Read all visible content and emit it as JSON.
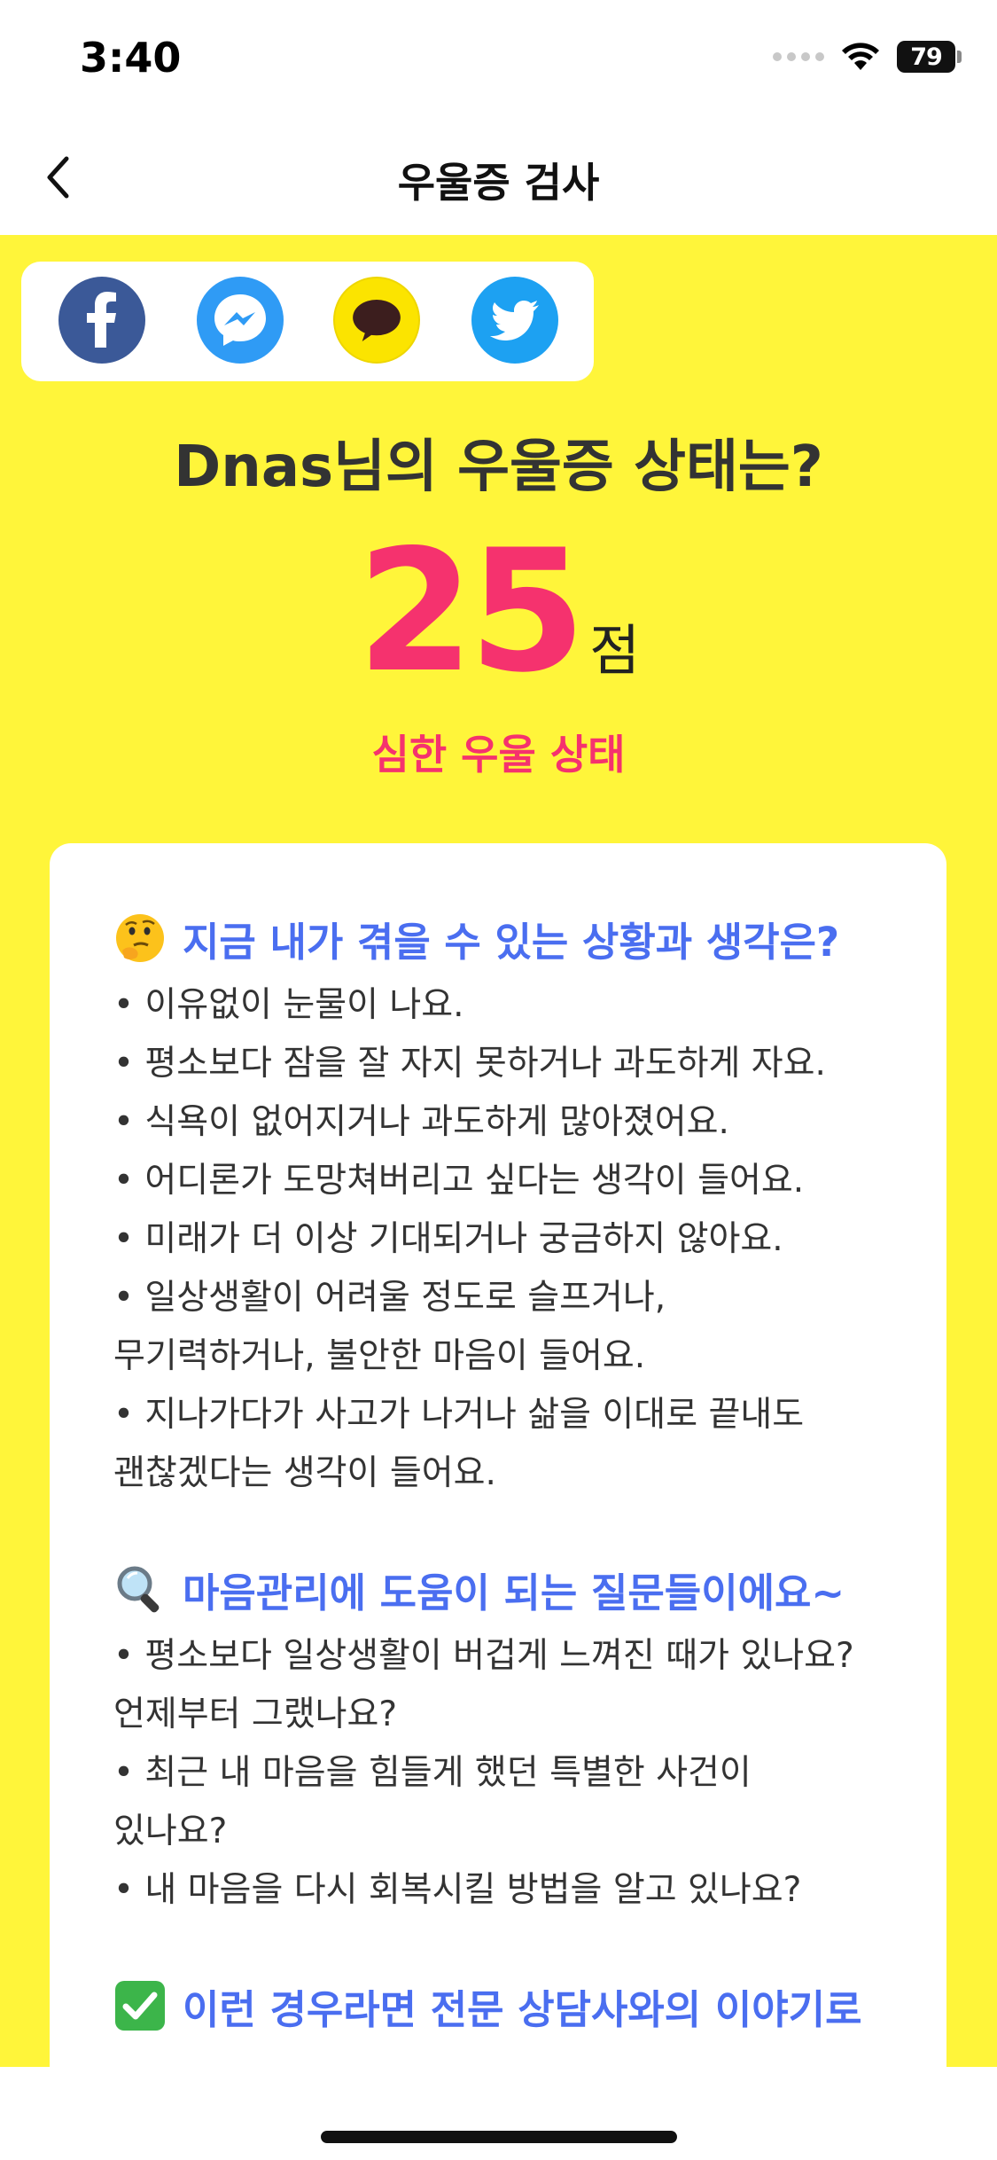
{
  "status_bar": {
    "time": "3:40",
    "battery": "79"
  },
  "nav": {
    "title": "우울증 검사"
  },
  "share": {
    "icons": [
      "facebook-icon",
      "messenger-icon",
      "kakaotalk-icon",
      "twitter-icon"
    ]
  },
  "result": {
    "title": "Dnas님의 우울증 상태는?",
    "score": "25",
    "unit": "점",
    "status": "심한 우울 상태"
  },
  "sections": [
    {
      "emoji": "thinking-face-icon",
      "title": "지금 내가 겪을 수 있는 상황과 생각은?",
      "lines": [
        "• 이유없이 눈물이 나요.",
        "• 평소보다 잠을 잘 자지 못하거나 과도하게 자요.",
        "• 식욕이 없어지거나 과도하게 많아졌어요.",
        "• 어디론가 도망쳐버리고 싶다는 생각이 들어요.",
        "• 미래가 더 이상 기대되거나 궁금하지 않아요.",
        "• 일상생활이 어려울 정도로 슬프거나,",
        "무기력하거나, 불안한 마음이 들어요.",
        "• 지나가다가 사고가 나거나 삶을 이대로 끝내도",
        "괜찮겠다는 생각이 들어요."
      ]
    },
    {
      "emoji": "magnifying-glass-icon",
      "title": "마음관리에 도움이 되는 질문들이에요~",
      "lines": [
        "• 평소보다 일상생활이 버겁게 느껴진 때가 있나요?",
        "언제부터 그랬나요?",
        "• 최근 내 마음을 힘들게 했던 특별한 사건이",
        "있나요?",
        "• 내 마음을 다시 회복시킬 방법을 알고 있나요?"
      ]
    },
    {
      "emoji": "check-mark-icon",
      "title": "이런 경우라면 전문 상담사와의 이야기로",
      "lines": []
    }
  ],
  "colors": {
    "background": "#fff53a",
    "accent_pink": "#f5326e",
    "accent_blue": "#4a6ef0"
  }
}
